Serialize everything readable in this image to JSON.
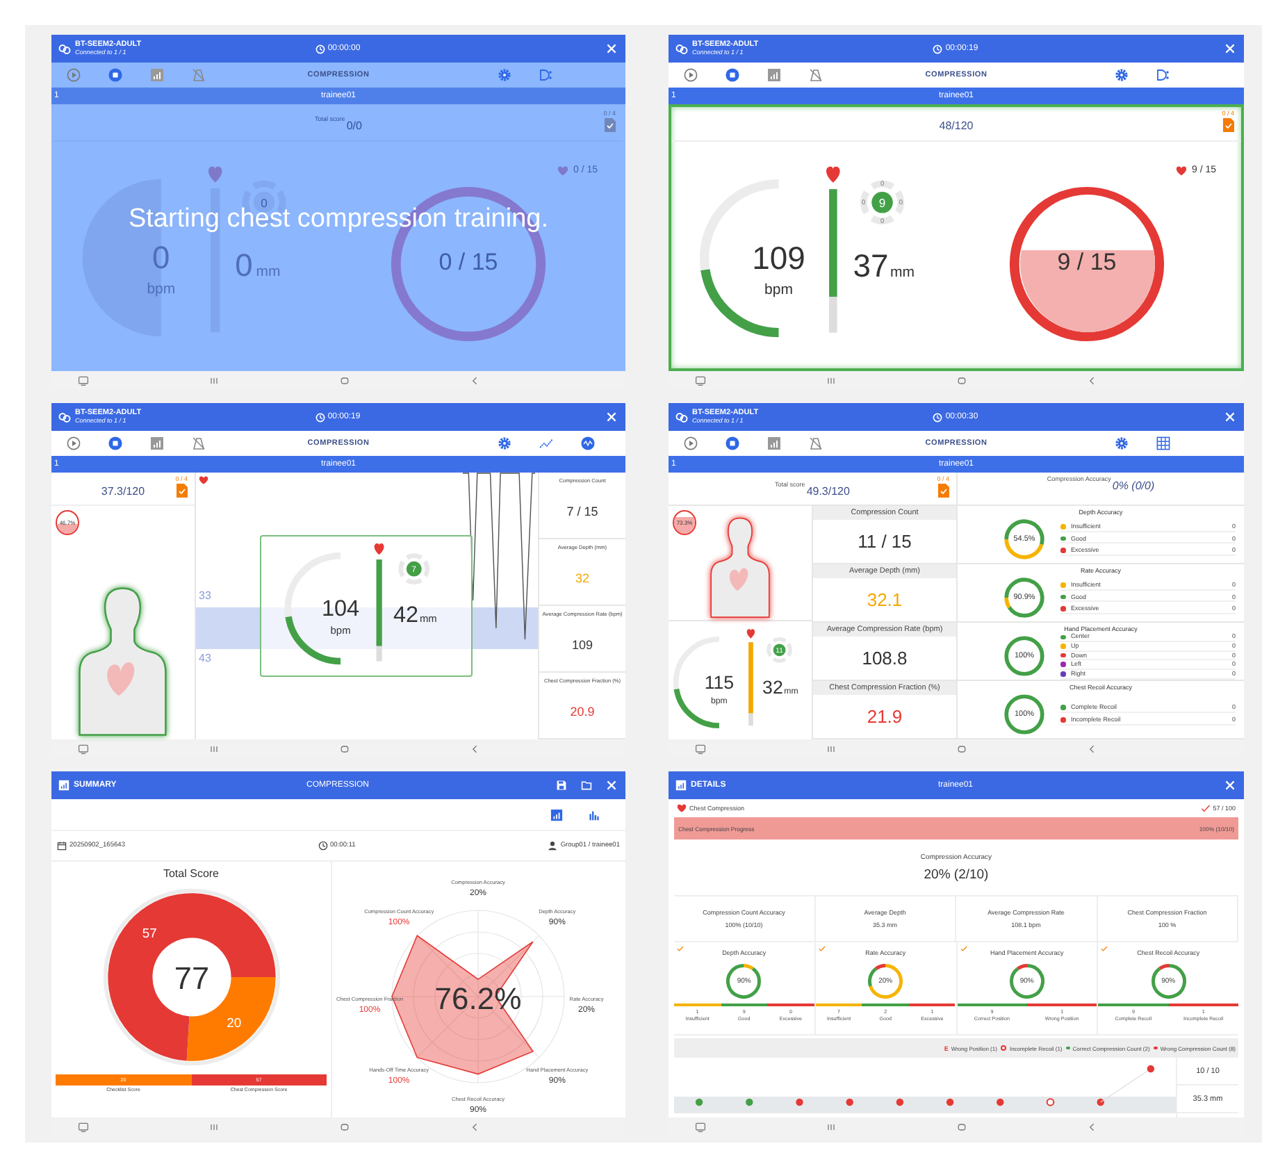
{
  "screens": [
    {
      "kind": "gauge",
      "active": false,
      "header": {
        "device": "BT-SEEM2-ADULT",
        "connection": "Connected to 1 / 1",
        "timer": "00:00:00"
      },
      "toolbar_title": "COMPRESSION",
      "trainee": {
        "number": "1",
        "name": "trainee01"
      },
      "score": {
        "label": "Total score",
        "value": "0/0",
        "checklist": "0 / 4"
      },
      "rate": {
        "value": "0",
        "unit": "bpm"
      },
      "depth": {
        "value": "0",
        "unit": "mm"
      },
      "position": {
        "count": "0"
      },
      "cycle": {
        "label": "0 / 15",
        "value": "0 / 15"
      },
      "overlay": "Starting chest compression training."
    },
    {
      "kind": "gauge",
      "active": true,
      "header": {
        "device": "BT-SEEM2-ADULT",
        "connection": "Connected to 1 / 1",
        "timer": "00:00:19"
      },
      "toolbar_title": "COMPRESSION",
      "trainee": {
        "number": "1",
        "name": "trainee01"
      },
      "score": {
        "value": "48/120",
        "checklist": "0 / 4"
      },
      "rate": {
        "value": "109",
        "unit": "bpm",
        "level": 0.45
      },
      "depth": {
        "value": "37",
        "unit": "mm",
        "level": 0.75,
        "color": "#43a047"
      },
      "position": {
        "count": "9",
        "marks": [
          "0",
          "0",
          "0",
          "0"
        ]
      },
      "cycle": {
        "label": "9 / 15",
        "value": "9 / 15",
        "level": 0.6
      }
    },
    {
      "kind": "graph",
      "header": {
        "device": "BT-SEEM2-ADULT",
        "connection": "Connected to 1 / 1",
        "timer": "00:00:19"
      },
      "toolbar_title": "COMPRESSION",
      "trainee": {
        "number": "1",
        "name": "trainee01"
      },
      "score": {
        "value": "37.3/120",
        "checklist": "0 / 4"
      },
      "body": {
        "badge": "46.7%",
        "level": 0.467,
        "color": "#43a047"
      },
      "band": {
        "upper": "33",
        "lower": "43"
      },
      "rate": {
        "value": "104",
        "unit": "bpm",
        "level": 0.45
      },
      "depth": {
        "value": "42",
        "unit": "mm",
        "level": 0.85,
        "color": "#43a047"
      },
      "position": {
        "count": "7"
      },
      "stats": [
        {
          "label": "Compression Count",
          "value": "7 / 15",
          "color": "#333333"
        },
        {
          "label": "Average Depth (mm)",
          "value": "32",
          "color": "#f5a800"
        },
        {
          "label": "Average Compression Rate (bpm)",
          "value": "109",
          "color": "#333333"
        },
        {
          "label": "Chest Compression Fraction (%)",
          "value": "20.9",
          "color": "#e53935"
        }
      ]
    },
    {
      "kind": "stats",
      "header": {
        "device": "BT-SEEM2-ADULT",
        "connection": "Connected to 1 / 1",
        "timer": "00:00:30"
      },
      "toolbar_title": "COMPRESSION",
      "trainee": {
        "number": "1",
        "name": "trainee01"
      },
      "score": {
        "label": "Total score",
        "value": "49.3/120",
        "checklist": "0 / 4"
      },
      "accuracy": {
        "label": "Compression Accuracy",
        "value": "0% (0/0)"
      },
      "body": {
        "badge": "73.3%",
        "level": 0.733,
        "color": "#e53935"
      },
      "rate": {
        "value": "115",
        "unit": "bpm",
        "level": 0.45
      },
      "depth": {
        "value": "32",
        "unit": "mm",
        "level": 0.85,
        "color": "#f5a800"
      },
      "position": {
        "count": "11"
      },
      "stats": [
        {
          "label": "Compression Count",
          "value": "11 / 15",
          "color": "#333333"
        },
        {
          "label": "Average Depth (mm)",
          "value": "32.1",
          "color": "#f5a800"
        },
        {
          "label": "Average Compression Rate (bpm)",
          "value": "108.8",
          "color": "#333333"
        },
        {
          "label": "Chest Compression Fraction (%)",
          "value": "21.9",
          "color": "#e53935"
        }
      ],
      "accuracies": [
        {
          "title": "Depth Accuracy",
          "value": "54.5%",
          "items": [
            {
              "label": "Insufficient",
              "count": "0",
              "color": "#f5b400"
            },
            {
              "label": "Good",
              "count": "0",
              "color": "#43a047"
            },
            {
              "label": "Excessive",
              "count": "0",
              "color": "#e53935"
            }
          ]
        },
        {
          "title": "Rate Accuracy",
          "value": "90.9%",
          "items": [
            {
              "label": "Insufficient",
              "count": "0",
              "color": "#f5b400"
            },
            {
              "label": "Good",
              "count": "0",
              "color": "#43a047"
            },
            {
              "label": "Excessive",
              "count": "0",
              "color": "#e53935"
            }
          ]
        },
        {
          "title": "Hand Placement Accuracy",
          "value": "100%",
          "items": [
            {
              "label": "Center",
              "count": "0",
              "color": "#43a047"
            },
            {
              "label": "Up",
              "count": "0",
              "color": "#f5b400"
            },
            {
              "label": "Down",
              "count": "0",
              "color": "#e53935"
            },
            {
              "label": "Left",
              "count": "0",
              "color": "#9c27b0"
            },
            {
              "label": "Right",
              "count": "0",
              "color": "#673ab7"
            }
          ]
        },
        {
          "title": "Chest Recoil Accuracy",
          "value": "100%",
          "items": [
            {
              "label": "Complete Recoil",
              "count": "0",
              "color": "#43a047"
            },
            {
              "label": "Incomplete Recoil",
              "count": "0",
              "color": "#e53935"
            }
          ]
        }
      ]
    },
    {
      "kind": "summary",
      "title": "SUMMARY",
      "subtitle": "COMPRESSION",
      "views": [
        {
          "selected": true
        },
        {
          "selected": false
        }
      ],
      "date": "20250902_165643",
      "duration": "00:00:11",
      "user": "Group01 / trainee01",
      "total": {
        "center": "77",
        "chart_data": {
          "type": "donut",
          "title": "Total Score",
          "categories": [
            "Checklist Score",
            "Chest Compression Score"
          ],
          "values": [
            20,
            57
          ],
          "data_labels": true
        },
        "slice_labels": [
          "20",
          "57"
        ],
        "bar": [
          {
            "value": "20",
            "color": "#ff7b00"
          },
          {
            "value": "57",
            "color": "#e53935"
          }
        ]
      },
      "radar": {
        "center": "76.2%",
        "axes": [
          {
            "label": "Compression Accuracy",
            "value": "20%",
            "highlight": false
          },
          {
            "label": "Depth Accuracy",
            "value": "90%",
            "highlight": false
          },
          {
            "label": "Rate Accuracy",
            "value": "20%",
            "highlight": false
          },
          {
            "label": "Hand Placement Accuracy",
            "value": "90%",
            "highlight": false
          },
          {
            "label": "Chest Recoil Accuracy",
            "value": "90%",
            "highlight": false
          },
          {
            "label": "Hands-Off Time Accuracy",
            "value": "100%",
            "highlight": true
          },
          {
            "label": "Chest Compression Fraction",
            "value": "100%",
            "highlight": true
          },
          {
            "label": "Compression Count Accuracy",
            "value": "100%",
            "highlight": true
          }
        ]
      }
    },
    {
      "kind": "details",
      "title": "DETAILS",
      "subtitle": "trainee01",
      "section": "Chest Compression",
      "section_score": "57 / 100",
      "progress": {
        "label": "Chest Compression Progress",
        "value": "100% (10/10)",
        "level": 1
      },
      "accuracy": {
        "label": "Compression Accuracy",
        "value": "20% (2/10)"
      },
      "metrics": [
        {
          "label": "Compression Count Accuracy",
          "value": "100% (10/10)"
        },
        {
          "label": "Average Depth",
          "value": "35.3 mm"
        },
        {
          "label": "Average Compression Rate",
          "value": "108.1 bpm"
        },
        {
          "label": "Chest Compression Fraction",
          "value": "100 %"
        }
      ],
      "cards": [
        {
          "title": "Depth Accuracy",
          "value": "90%",
          "checked": true,
          "items": [
            {
              "count": "1",
              "label": "Insufficient",
              "color": "#f5b400"
            },
            {
              "count": "9",
              "label": "Good",
              "color": "#43a047"
            },
            {
              "count": "0",
              "label": "Excessive",
              "color": "#e53935"
            }
          ]
        },
        {
          "title": "Rate Accuracy",
          "value": "20%",
          "checked": true,
          "items": [
            {
              "count": "7",
              "label": "Insufficient",
              "color": "#f5b400"
            },
            {
              "count": "2",
              "label": "Good",
              "color": "#43a047"
            },
            {
              "count": "1",
              "label": "Excessive",
              "color": "#e53935"
            }
          ]
        },
        {
          "title": "Hand Placement Accuracy",
          "value": "90%",
          "checked": true,
          "items": [
            {
              "count": "9",
              "label": "Correct Position",
              "color": "#43a047"
            },
            {
              "count": "1",
              "label": "Wrong Position",
              "color": "#e53935"
            }
          ]
        },
        {
          "title": "Chest Recoil Accuracy",
          "value": "90%",
          "checked": true,
          "items": [
            {
              "count": "9",
              "label": "Complete Recoil",
              "color": "#43a047"
            },
            {
              "count": "1",
              "label": "Incomplete Recoil",
              "color": "#e53935"
            }
          ]
        }
      ],
      "legend": [
        {
          "kind": "letter",
          "mark": "E",
          "label": "Wrong Position (1)",
          "color": "#e53935"
        },
        {
          "kind": "ring",
          "label": "Incomplete Recoil (1)",
          "color": "#e53935"
        },
        {
          "kind": "dot",
          "label": "Correct Compression Count (2)",
          "color": "#43a047"
        },
        {
          "kind": "dot",
          "label": "Wrong Compression Count (8)",
          "color": "#e53935"
        }
      ],
      "points": [
        {
          "kind": "dot",
          "color": "#43a047",
          "raised": false
        },
        {
          "kind": "dot",
          "color": "#43a047",
          "raised": false
        },
        {
          "kind": "dot",
          "color": "#e53935",
          "raised": false
        },
        {
          "kind": "dot",
          "color": "#e53935",
          "raised": false
        },
        {
          "kind": "dot",
          "color": "#e53935",
          "raised": false
        },
        {
          "kind": "dot",
          "color": "#e53935",
          "raised": false
        },
        {
          "kind": "dot",
          "color": "#e53935",
          "raised": false
        },
        {
          "kind": "ring",
          "color": "#e53935",
          "raised": false
        },
        {
          "kind": "dot",
          "color": "#e53935",
          "raised": false
        },
        {
          "kind": "dot",
          "color": "#e53935",
          "raised": true
        }
      ],
      "side": [
        "10 / 10",
        "35.3 mm"
      ]
    }
  ]
}
